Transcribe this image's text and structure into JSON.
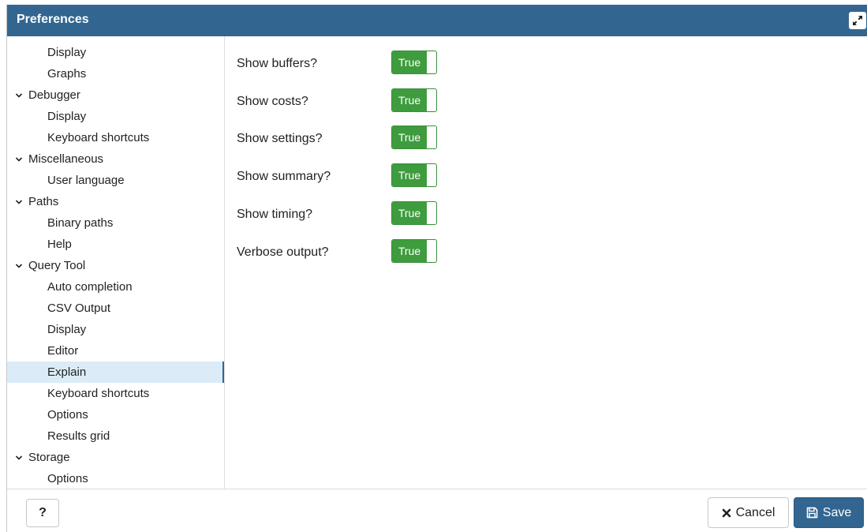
{
  "dialog": {
    "title": "Preferences",
    "maximize_icon": "expand-icon"
  },
  "sidebar": {
    "items": [
      {
        "label": "Display",
        "level": "child"
      },
      {
        "label": "Graphs",
        "level": "child"
      },
      {
        "label": "Debugger",
        "level": "parent",
        "expanded": true
      },
      {
        "label": "Display",
        "level": "child"
      },
      {
        "label": "Keyboard shortcuts",
        "level": "child"
      },
      {
        "label": "Miscellaneous",
        "level": "parent",
        "expanded": true
      },
      {
        "label": "User language",
        "level": "child"
      },
      {
        "label": "Paths",
        "level": "parent",
        "expanded": true
      },
      {
        "label": "Binary paths",
        "level": "child"
      },
      {
        "label": "Help",
        "level": "child"
      },
      {
        "label": "Query Tool",
        "level": "parent",
        "expanded": true
      },
      {
        "label": "Auto completion",
        "level": "child"
      },
      {
        "label": "CSV Output",
        "level": "child"
      },
      {
        "label": "Display",
        "level": "child"
      },
      {
        "label": "Editor",
        "level": "child"
      },
      {
        "label": "Explain",
        "level": "child",
        "selected": true
      },
      {
        "label": "Keyboard shortcuts",
        "level": "child"
      },
      {
        "label": "Options",
        "level": "child"
      },
      {
        "label": "Results grid",
        "level": "child"
      },
      {
        "label": "Storage",
        "level": "parent",
        "expanded": true
      },
      {
        "label": "Options",
        "level": "child"
      }
    ]
  },
  "settings": [
    {
      "label": "Show buffers?",
      "value": "True"
    },
    {
      "label": "Show costs?",
      "value": "True"
    },
    {
      "label": "Show settings?",
      "value": "True"
    },
    {
      "label": "Show summary?",
      "value": "True"
    },
    {
      "label": "Show timing?",
      "value": "True"
    },
    {
      "label": "Verbose output?",
      "value": "True"
    }
  ],
  "footer": {
    "help_label": "?",
    "cancel_label": "Cancel",
    "save_label": "Save"
  },
  "colors": {
    "titlebar": "#326690",
    "toggle_on": "#3e9c3e",
    "selected_row": "#dbecf8"
  }
}
